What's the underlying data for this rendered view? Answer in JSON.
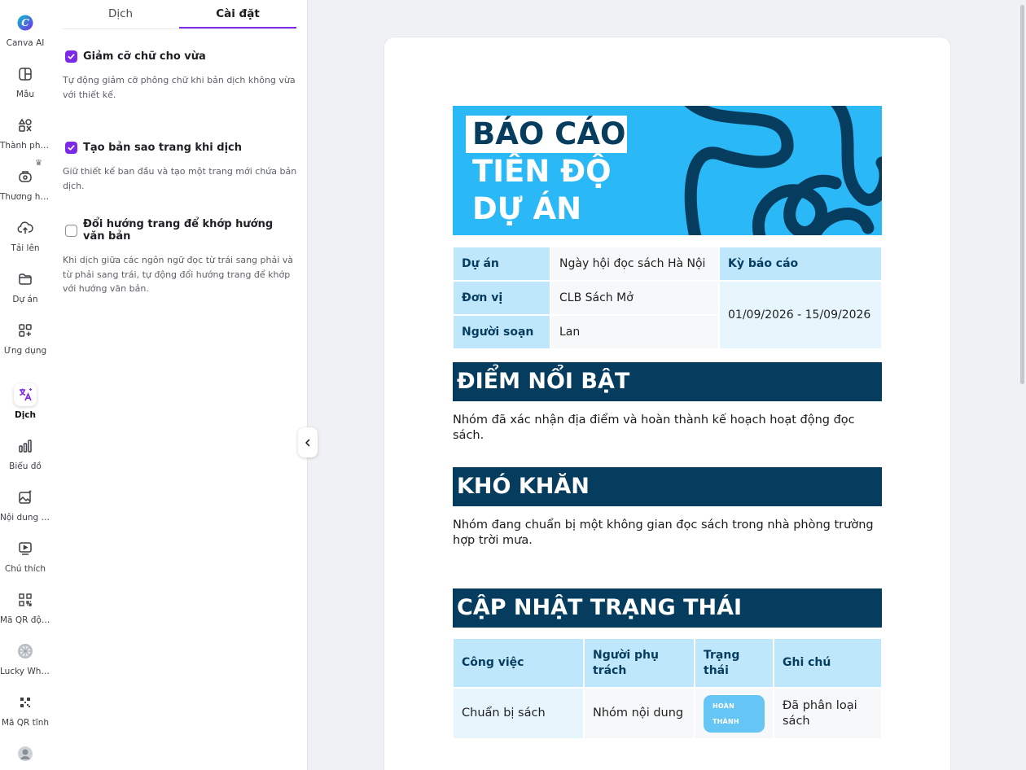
{
  "rail": {
    "items": [
      {
        "label": "Canva AI",
        "icon": "canva-ai-icon"
      },
      {
        "label": "Mẫu",
        "icon": "template-icon"
      },
      {
        "label": "Thành phần",
        "icon": "elements-icon"
      },
      {
        "label": "Thương hiệu",
        "icon": "brand-icon"
      },
      {
        "label": "Tải lên",
        "icon": "upload-icon"
      },
      {
        "label": "Dự án",
        "icon": "folder-icon"
      },
      {
        "label": "Ứng dụng",
        "icon": "apps-icon"
      },
      {
        "label": "Dịch",
        "icon": "translate-icon"
      },
      {
        "label": "Biểu đồ",
        "icon": "chart-icon"
      },
      {
        "label": "Nội dung Magic Media",
        "icon": "magic-media-icon"
      },
      {
        "label": "Chú thích",
        "icon": "caption-icon"
      },
      {
        "label": "Mã QR động",
        "icon": "dynamic-qr-icon"
      },
      {
        "label": "Lucky Wheel",
        "icon": "lucky-wheel-icon"
      },
      {
        "label": "Mã QR tĩnh",
        "icon": "static-qr-icon"
      }
    ],
    "active": "Dịch"
  },
  "panel": {
    "tabs": [
      {
        "label": "Dịch"
      },
      {
        "label": "Cài đặt"
      }
    ],
    "active_tab": "Cài đặt",
    "options": [
      {
        "title": "Giảm cỡ chữ cho vừa",
        "desc": "Tự động giảm cỡ phông chữ khi bản dịch không vừa với thiết kế.",
        "checked": true
      },
      {
        "title": "Tạo bản sao trang khi dịch",
        "desc": "Giữ thiết kế ban đầu và tạo một trang mới chứa bản dịch.",
        "checked": true
      },
      {
        "title": "Đổi hướng trang để khớp hướng văn bản",
        "desc": "Khi dịch giữa các ngôn ngữ đọc từ trái sang phải và từ phải sang trái, tự động đổi hướng trang để khớp với hướng văn bản.",
        "checked": false
      }
    ]
  },
  "doc": {
    "hero": {
      "line1": "BÁO CÁO",
      "line2": "TIẾN ĐỘ",
      "line3": "DỰ ÁN"
    },
    "info": {
      "project_label": "Dự án",
      "project_value": "Ngày hội đọc sách Hà Nội",
      "period_label": "Kỳ báo cáo",
      "period_value": "01/09/2026 - 15/09/2026",
      "unit_label": "Đơn vị",
      "unit_value": "CLB Sách Mở",
      "author_label": "Người soạn",
      "author_value": "Lan"
    },
    "highlights": {
      "heading": "ĐIỂM NỔI BẬT",
      "text": "Nhóm đã xác nhận địa điểm và hoàn thành kế hoạch hoạt động đọc sách."
    },
    "challenges": {
      "heading": "KHÓ KHĂN",
      "text": "Nhóm đang chuẩn bị một không gian đọc sách trong nhà phòng trường hợp trời mưa."
    },
    "status": {
      "heading": "CẬP NHẬT TRẠNG THÁI",
      "columns": [
        "Công việc",
        "Người phụ trách",
        "Trạng thái",
        "Ghi chú"
      ],
      "rows": [
        {
          "task": "Chuẩn bị sách",
          "owner": "Nhóm nội dung",
          "state": "HOÀN THÀNH",
          "note": "Đã phân loại sách"
        }
      ]
    }
  },
  "colors": {
    "accent": "#7d2ae8",
    "hero_bg": "#2bb8f6",
    "navy": "#063d5f",
    "light_blue": "#bfe7fb",
    "badge": "#65c6f5"
  }
}
